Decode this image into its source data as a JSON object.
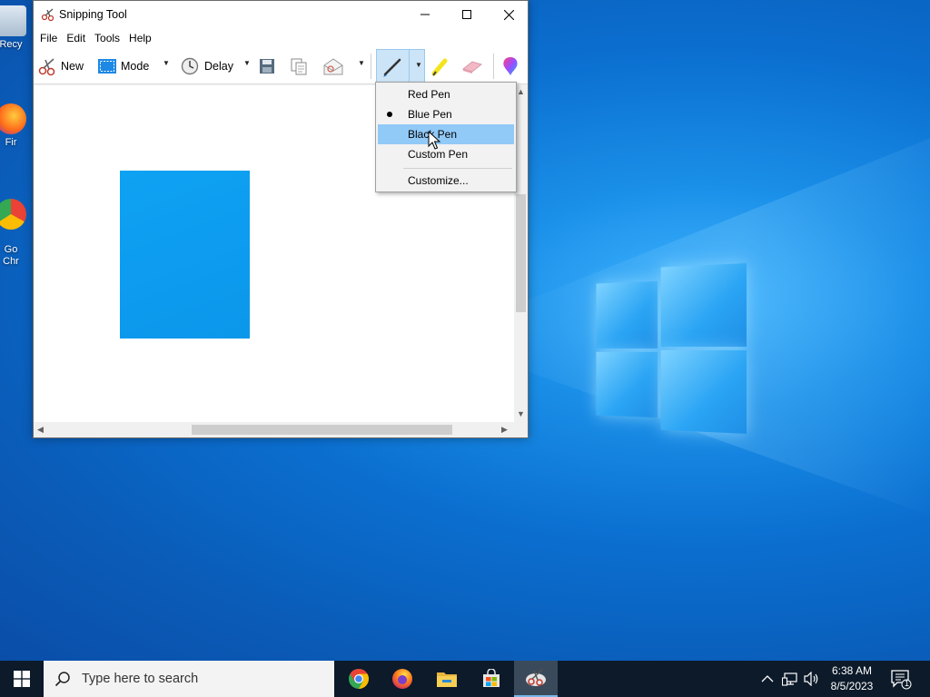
{
  "window": {
    "title": "Snipping Tool",
    "menu": [
      "File",
      "Edit",
      "Tools",
      "Help"
    ],
    "toolbar": {
      "new_label": "New",
      "mode_label": "Mode",
      "delay_label": "Delay"
    }
  },
  "pen_menu": {
    "items": [
      "Red Pen",
      "Blue Pen",
      "Black Pen",
      "Custom Pen"
    ],
    "selected": "Blue Pen",
    "hovered": "Black Pen",
    "customize_label": "Customize..."
  },
  "desktop": {
    "icons": [
      "Recy",
      "Fir",
      "Go\nChr"
    ]
  },
  "taskbar": {
    "search_placeholder": "Type here to search",
    "time": "6:38 AM",
    "date": "8/5/2023",
    "notification_count": "1"
  },
  "colors": {
    "snip_fill": "#0ea2f2",
    "menu_hover": "#91c9f7",
    "pen_button_active": "#cce4f7",
    "taskbar": "#0c1a2a"
  }
}
